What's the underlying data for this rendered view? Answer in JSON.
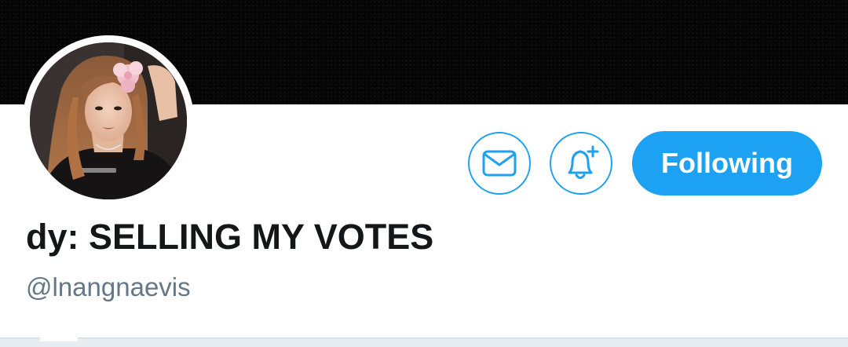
{
  "profile": {
    "display_name": "dy: SELLING MY VOTES",
    "handle": "@lnangnaevis"
  },
  "actions": {
    "message_icon": "envelope-icon",
    "notify_icon": "bell-plus-icon",
    "follow_label": "Following"
  },
  "colors": {
    "accent": "#1da1f2",
    "banner": "#050505",
    "name_text": "#14171a",
    "handle_text": "#657786",
    "divider": "#e6ecf0"
  }
}
